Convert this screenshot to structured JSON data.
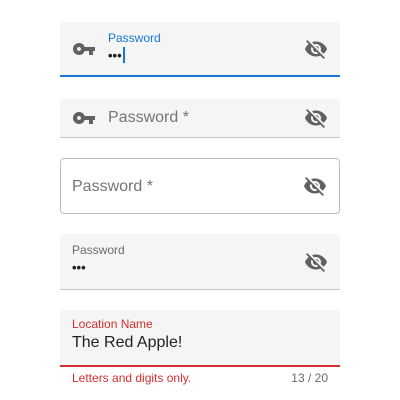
{
  "fields": [
    {
      "label": "Password",
      "value": "•••",
      "leading_icon": "key-icon",
      "trailing_icon": "eye-off-icon",
      "state": "focused",
      "accent": "#1976d2"
    },
    {
      "label": "Password *",
      "value": "",
      "leading_icon": "key-icon",
      "trailing_icon": "eye-off-icon",
      "state": "empty-filled"
    },
    {
      "label": "Password *",
      "value": "",
      "trailing_icon": "eye-off-icon",
      "state": "empty-outlined"
    },
    {
      "label": "Password",
      "value": "•••",
      "trailing_icon": "eye-off-icon",
      "state": "filled"
    },
    {
      "label": "Location Name",
      "value": "The Red Apple!",
      "helper": "Letters and digits only.",
      "counter": "13 / 20",
      "state": "error",
      "accent": "#d32f2f"
    }
  ]
}
